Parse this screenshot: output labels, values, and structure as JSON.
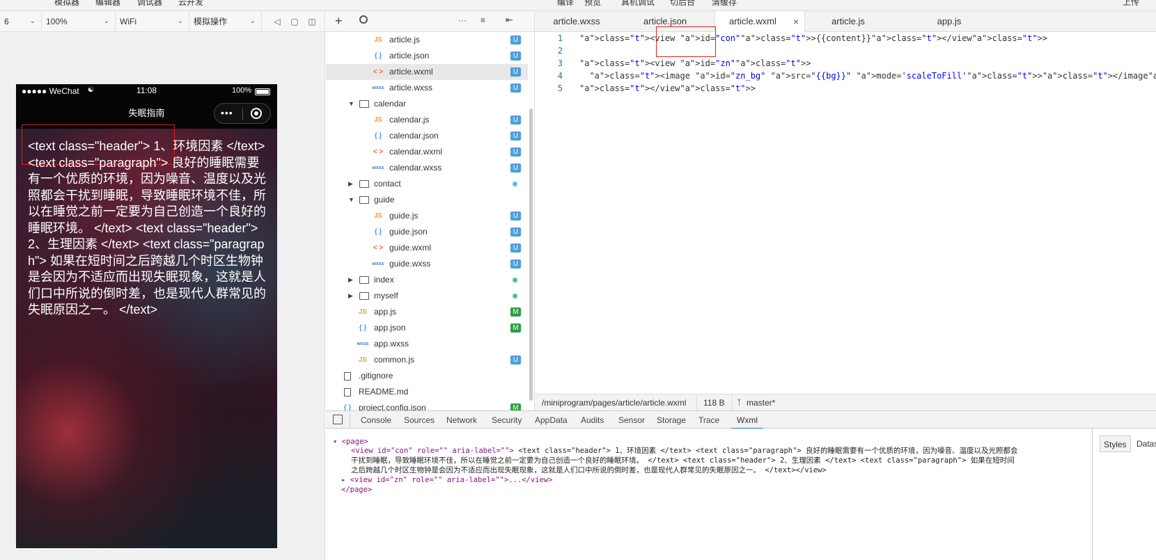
{
  "top_menu": [
    "模拟器",
    "编辑器",
    "调试器",
    "云开发",
    "编译",
    "预览",
    "真机调试",
    "切后台",
    "清缓存",
    "上传"
  ],
  "sim_toolbar": {
    "device": "6",
    "zoom": "100%",
    "network": "WiFi",
    "operation": "模拟操作"
  },
  "phone": {
    "status": {
      "signal": "●●●●● WeChat",
      "time": "11:08",
      "battery": "100%"
    },
    "nav_title": "失眠指南",
    "content": "<text class=\"header\"> 1、环境因素 </text> <text class=\"paragraph\"> 良好的睡眠需要有一个优质的环境，因为噪音、温度以及光照都会干扰到睡眠，导致睡眠环境不佳，所以在睡觉之前一定要为自己创造一个良好的睡眠环境。 </text> <text class=\"header\"> 2、生理因素 </text> <text class=\"paragraph\"> 如果在短时间之后跨越几个时区生物钟是会因为不适应而出现失眠现象，这就是人们口中所说的倒时差，也是现代人群常见的失眠原因之一。 </text>"
  },
  "tree": [
    {
      "name": "article.js",
      "type": "js",
      "indent": 2,
      "badge": "U"
    },
    {
      "name": "article.json",
      "type": "json",
      "indent": 2,
      "badge": "U"
    },
    {
      "name": "article.wxml",
      "type": "wxml",
      "indent": 2,
      "badge": "U",
      "active": true
    },
    {
      "name": "article.wxss",
      "type": "wxss",
      "indent": 2,
      "badge": "U"
    },
    {
      "name": "calendar",
      "type": "folder-open",
      "indent": 1
    },
    {
      "name": "calendar.js",
      "type": "js",
      "indent": 2,
      "badge": "U"
    },
    {
      "name": "calendar.json",
      "type": "json",
      "indent": 2,
      "badge": "U"
    },
    {
      "name": "calendar.wxml",
      "type": "wxml",
      "indent": 2,
      "badge": "U"
    },
    {
      "name": "calendar.wxss",
      "type": "wxss",
      "indent": 2,
      "badge": "U"
    },
    {
      "name": "contact",
      "type": "folder",
      "indent": 1,
      "dot": "#5bc0de"
    },
    {
      "name": "guide",
      "type": "folder-open",
      "indent": 1
    },
    {
      "name": "guide.js",
      "type": "js",
      "indent": 2,
      "badge": "U"
    },
    {
      "name": "guide.json",
      "type": "json",
      "indent": 2,
      "badge": "U"
    },
    {
      "name": "guide.wxml",
      "type": "wxml",
      "indent": 2,
      "badge": "U"
    },
    {
      "name": "guide.wxss",
      "type": "wxss",
      "indent": 2,
      "badge": "U"
    },
    {
      "name": "index",
      "type": "folder",
      "indent": 1,
      "dot": "#4cc38a"
    },
    {
      "name": "myself",
      "type": "folder",
      "indent": 1,
      "dot": "#4cc38a"
    },
    {
      "name": "app.js",
      "type": "js",
      "indent": 1,
      "badge": "M"
    },
    {
      "name": "app.json",
      "type": "json",
      "indent": 1,
      "badge": "M"
    },
    {
      "name": "app.wxss",
      "type": "wxss",
      "indent": 1
    },
    {
      "name": "common.js",
      "type": "js",
      "indent": 1,
      "badge": "U"
    },
    {
      "name": ".gitignore",
      "type": "file",
      "indent": 0
    },
    {
      "name": "README.md",
      "type": "file",
      "indent": 0
    },
    {
      "name": "project.config.json",
      "type": "json",
      "indent": 0,
      "badge": "M"
    }
  ],
  "editor_tabs": [
    "article.wxss",
    "article.json",
    "article.wxml",
    "article.js",
    "app.js"
  ],
  "code_lines": [
    [
      "1",
      "<view id=\"con\">{{content}}</view>"
    ],
    [
      "2",
      ""
    ],
    [
      "3",
      "<view id=\"zn\">"
    ],
    [
      "4",
      "  <image id=\"zn_bg\" src=\"{{bg}}\" mode='scaleToFill'></image>"
    ],
    [
      "5",
      "</view>"
    ]
  ],
  "status_bar": {
    "path": "/miniprogram/pages/article/article.wxml",
    "size": "118 B",
    "branch": "master*"
  },
  "dev_tabs": [
    "Console",
    "Sources",
    "Network",
    "Security",
    "AppData",
    "Audits",
    "Sensor",
    "Storage",
    "Trace",
    "Wxml"
  ],
  "wxml_tree": {
    "page_open": "<page>",
    "view_con_open": "<view  id=\"con\"  role=\"\"  aria-label=\"\">",
    "view_con_text_1": "<text class=\"header\"> 1、环境因素 </text> <text class=\"paragraph\"> 良好的睡眠需要有一个优质的环境，因为噪音、温度以及光照都会",
    "view_con_text_2": "干扰到睡眠，导致睡眠环境不佳，所以在睡觉之前一定要为自己创造一个良好的睡眠环境。 </text> <text class=\"header\"> 2、生理因素 </text> <text class=\"paragraph\"> 如果在短时间",
    "view_con_text_3": "之后跨越几个时区生物钟是会因为不适应而出现失眠现象，这就是人们口中所说的倒时差，也是现代人群常见的失眠原因之一。 </text></view>",
    "view_zn": "<view  id=\"zn\"  role=\"\"  aria-label=\"\">...</view>",
    "page_close": "</page>"
  },
  "side_tabs": [
    "Styles",
    "Dataset"
  ],
  "colors": {
    "badge_u": "#4a9fd8",
    "badge_m": "#2ea043",
    "active_tab_line": "#1a73e8"
  }
}
